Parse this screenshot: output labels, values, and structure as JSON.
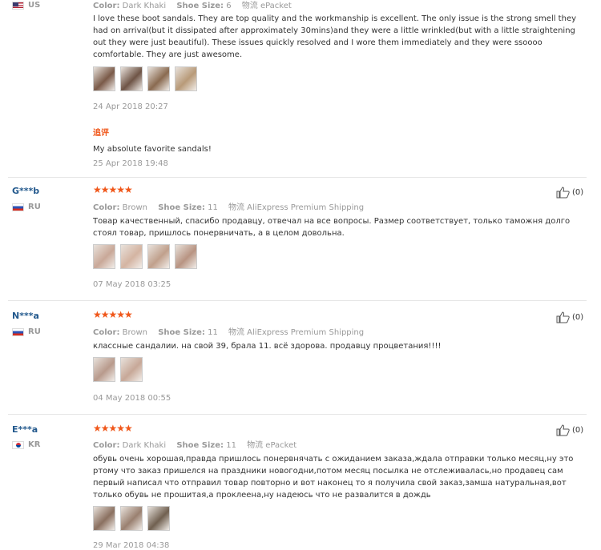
{
  "labels": {
    "color": "Color:",
    "shoe_size": "Shoe Size:"
  },
  "additional_feedback_label": "追评",
  "reviews": [
    {
      "country": "US",
      "color": "Dark Khaki",
      "size": "6",
      "shipping": "物流 ePacket",
      "text": "I love these boot sandals. They are top quality and the workmanship is excellent. The only issue is the strong smell they had on arrival(but it dissipated after approximately 30mins)and they were a little wrinkled(but with a little straightening out they were just beautiful). These issues quickly resolved and I wore them immediately and they were ssoooo comfortable. They are just awesome.",
      "date": "24 Apr 2018 20:27",
      "additional_text": "My absolute favorite sandals!",
      "additional_date": "25 Apr 2018 19:48",
      "photo_colors": [
        "#7a5a48",
        "#6e5446",
        "#8a6a50",
        "#b89a78"
      ]
    },
    {
      "user": "G***b",
      "country": "RU",
      "stars": "★★★★★",
      "color": "Brown",
      "size": "11",
      "shipping": "物流 AliExpress Premium Shipping",
      "helpful": "(0)",
      "text": "Товар качественный, спасибо продавцу, отвечал на все вопросы. Размер соответствует, только таможня долго стоял товар, пришлось понервничать, а в целом довольна.",
      "date": "07 May 2018 03:25",
      "photo_colors": [
        "#c9a898",
        "#d4b4a2",
        "#c0a08c",
        "#b89482"
      ]
    },
    {
      "user": "N***a",
      "country": "RU",
      "stars": "★★★★★",
      "color": "Brown",
      "size": "11",
      "shipping": "物流 AliExpress Premium Shipping",
      "helpful": "(0)",
      "text": "классные сандалии. на свой 39, брала 11. всё здорова. продавцу процветания!!!!",
      "date": "04 May 2018 00:55",
      "photo_colors": [
        "#b89a8c",
        "#c7a898"
      ]
    },
    {
      "user": "E***a",
      "country": "KR",
      "stars": "★★★★★",
      "color": "Dark Khaki",
      "size": "11",
      "shipping": "物流 ePacket",
      "helpful": "(0)",
      "text": "обувь очень хорошая,правда пришлось понервнячать с ожиданием заказа,ждала отправки только месяц,ну это ртому что заказ пришелся на праздники новогодни,потом месяц посылка не отслеживалась,но продавец сам первый написал что отправил товар повторно и вот наконец то я получила свой заказ,замша натуральная,вот только обувь не прошитая,а проклеена,ну надеюсь что не развалится в дождь",
      "date": "29 Mar 2018 04:38",
      "photo_colors": [
        "#8a7060",
        "#9a8070",
        "#706050"
      ]
    }
  ]
}
